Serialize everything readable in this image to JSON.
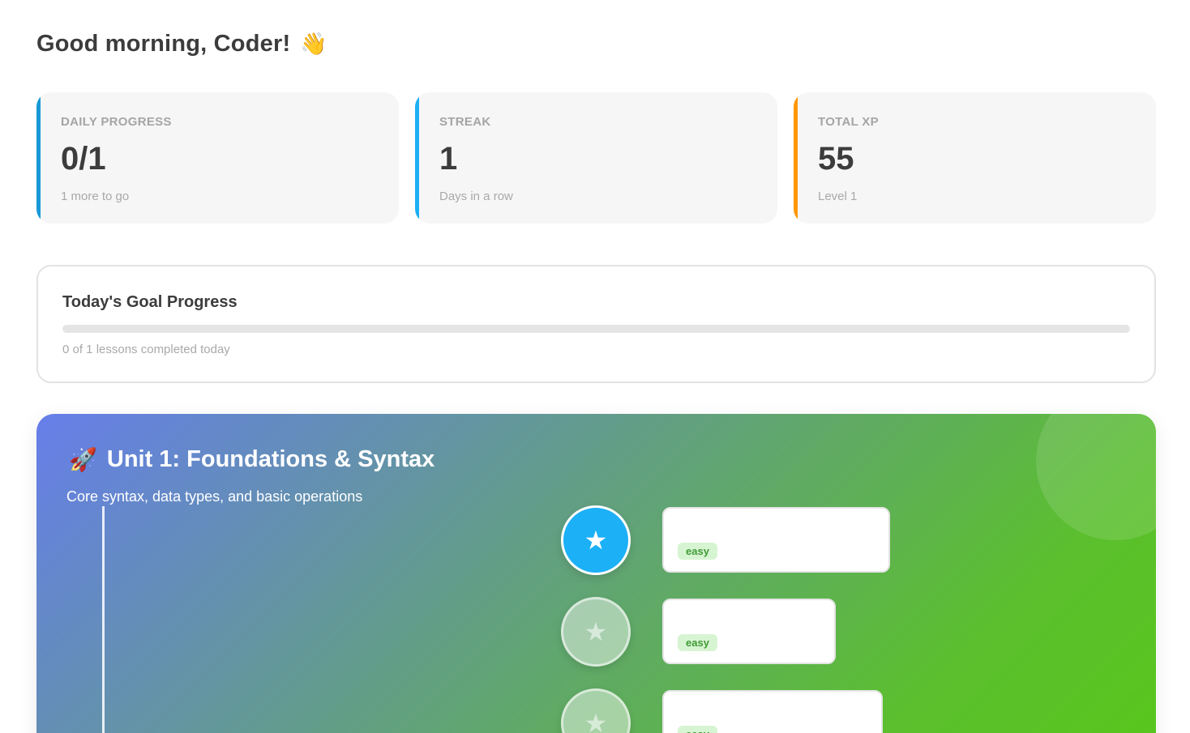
{
  "greeting": {
    "text": "Good morning, Coder!",
    "emoji": "👋"
  },
  "stats": [
    {
      "label": "DAILY PROGRESS",
      "value": "0/1",
      "sub": "1 more to go",
      "accent": "#1899d6"
    },
    {
      "label": "STREAK",
      "value": "1",
      "sub": "Days in a row",
      "accent": "#1cb0f6"
    },
    {
      "label": "TOTAL XP",
      "value": "55",
      "sub": "Level 1",
      "accent": "#ff9600"
    }
  ],
  "goal": {
    "title": "Today's Goal Progress",
    "progress": 0,
    "caption": "0 of 1 lessons completed today"
  },
  "unit": {
    "icon": "🚀",
    "title": "Unit 1: Foundations & Syntax",
    "description": "Core syntax, data types, and basic operations",
    "lessons": [
      {
        "icon": "star-icon",
        "glyph": "★",
        "state": "active",
        "difficulty": "easy"
      },
      {
        "icon": "star-icon",
        "glyph": "★",
        "state": "locked",
        "difficulty": "easy"
      },
      {
        "icon": "star-icon",
        "glyph": "★",
        "state": "locked",
        "difficulty": "easy"
      }
    ]
  },
  "colors": {
    "active_node": "#1cb0f6",
    "gradient_start": "#667eea",
    "gradient_end": "#58cc02",
    "difficulty_easy_bg": "#d7f4d2",
    "difficulty_easy_text": "#3f9b36"
  }
}
